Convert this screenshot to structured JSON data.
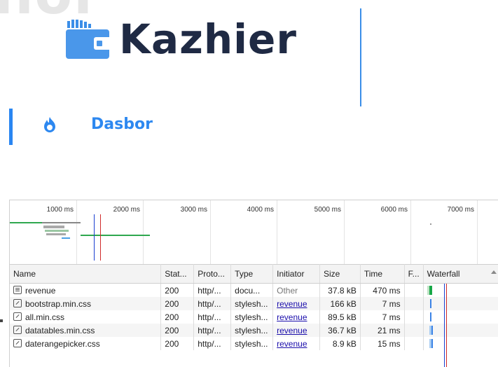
{
  "app": {
    "ghost_text": "nor",
    "brand": "Kazhier",
    "nav_label": "Dasbor",
    "colors": {
      "brand_blue": "#2a86f2",
      "logo_text": "#1f2a44",
      "logo_icon": "#3b8ee8"
    }
  },
  "devtools": {
    "ticks": [
      "1000 ms",
      "2000 ms",
      "3000 ms",
      "4000 ms",
      "5000 ms",
      "6000 ms",
      "7000 ms"
    ],
    "columns": [
      "Name",
      "Stat...",
      "Proto...",
      "Type",
      "Initiator",
      "Size",
      "Time",
      "F...",
      "Waterfall"
    ],
    "rows": [
      {
        "name": "revenue",
        "icon": "document-icon",
        "status": "200",
        "protocol": "http/...",
        "type": "docu...",
        "initiator": "Other",
        "size": "37.8 kB",
        "time": "470 ms"
      },
      {
        "name": "bootstrap.min.css",
        "icon": "stylesheet-icon",
        "status": "200",
        "protocol": "http/...",
        "type": "stylesh...",
        "initiator": "revenue",
        "size": "166 kB",
        "time": "7 ms"
      },
      {
        "name": "all.min.css",
        "icon": "stylesheet-icon",
        "status": "200",
        "protocol": "http/...",
        "type": "stylesh...",
        "initiator": "revenue",
        "size": "89.5 kB",
        "time": "7 ms"
      },
      {
        "name": "datatables.min.css",
        "icon": "stylesheet-icon",
        "status": "200",
        "protocol": "http/...",
        "type": "stylesh...",
        "initiator": "revenue",
        "size": "36.7 kB",
        "time": "21 ms"
      },
      {
        "name": "daterangepicker.css",
        "icon": "stylesheet-icon",
        "status": "200",
        "protocol": "http/...",
        "type": "stylesh...",
        "initiator": "revenue",
        "size": "8.9 kB",
        "time": "15 ms"
      }
    ]
  }
}
